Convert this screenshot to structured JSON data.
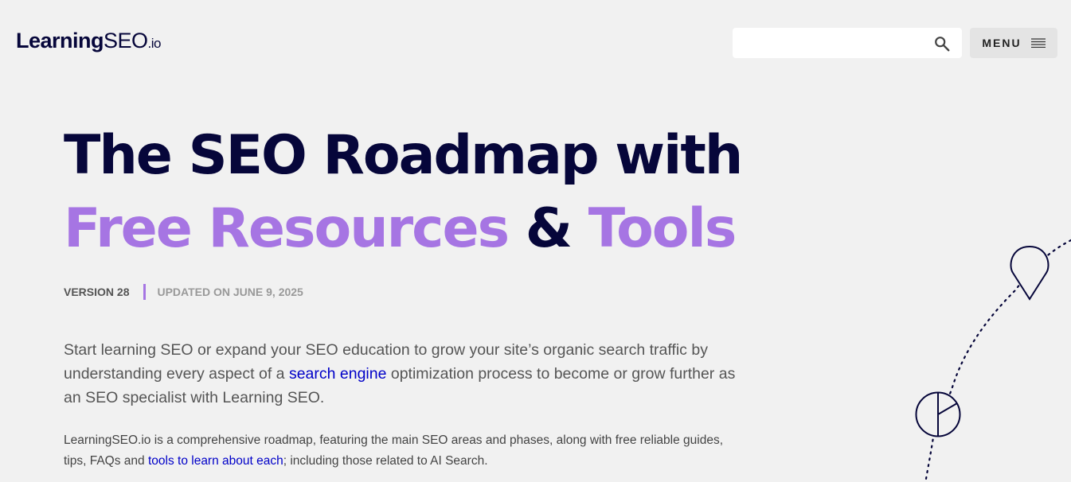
{
  "header": {
    "logo": {
      "part1": "Learning",
      "part2": "SEO",
      "part3": ".io"
    },
    "search": {
      "placeholder": "",
      "value": ""
    },
    "menu": {
      "label": "MENU"
    }
  },
  "hero": {
    "title_line1": "The SEO Roadmap with",
    "title_part_a": "Free Resources",
    "title_amp": " & ",
    "title_part_b": "Tools",
    "version": "VERSION 28",
    "updated": "UPDATED ON JUNE 9, 2025"
  },
  "intro": {
    "text_before": "Start learning SEO or expand your SEO education to grow your site’s organic search traffic by understanding every aspect of a ",
    "link": "search engine",
    "text_after": " optimization process to become or grow further as an SEO specialist with Learning SEO."
  },
  "body2": {
    "text_before": "LearningSEO.io is a comprehensive roadmap, featuring the main SEO areas and phases, along with free reliable guides, tips, FAQs and ",
    "link": "tools to learn about each",
    "text_after": "; including those related to AI Search."
  },
  "colors": {
    "navy": "#06063a",
    "accent_purple": "#a675e3",
    "link_blue": "#0000c8",
    "background": "#f1f1f1"
  },
  "icons": [
    "search-icon",
    "hamburger-icon",
    "map-pin-icon",
    "pie-chart-icon"
  ]
}
